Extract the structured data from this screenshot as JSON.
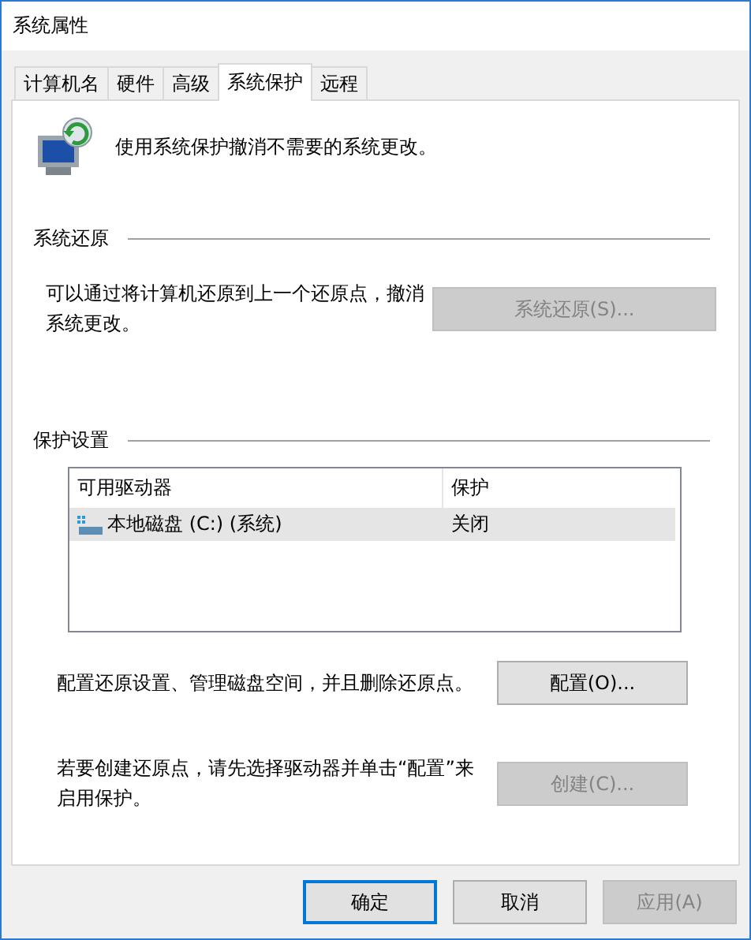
{
  "window": {
    "title": "系统属性"
  },
  "tabs": [
    {
      "label": "计算机名",
      "selected": false
    },
    {
      "label": "硬件",
      "selected": false
    },
    {
      "label": "高级",
      "selected": false
    },
    {
      "label": "系统保护",
      "selected": true
    },
    {
      "label": "远程",
      "selected": false
    }
  ],
  "intro": "使用系统保护撤消不需要的系统更改。",
  "restore": {
    "heading": "系统还原",
    "text": "可以通过将计算机还原到上一个还原点，撤消系统更改。",
    "button": {
      "label": "系统还原(S)...",
      "disabled": true
    }
  },
  "protection": {
    "heading": "保护设置",
    "columns": [
      "可用驱动器",
      "保护"
    ],
    "rows": [
      {
        "name": "本地磁盘 (C:) (系统)",
        "protection": "关闭",
        "selected": true
      }
    ],
    "configure": {
      "text": "配置还原设置、管理磁盘空间，并且删除还原点。",
      "button": {
        "label": "配置(O)...",
        "disabled": false
      }
    },
    "create": {
      "text": "若要创建还原点，请先选择驱动器并单击“配置”来启用保护。",
      "button": {
        "label": "创建(C)...",
        "disabled": true
      }
    }
  },
  "buttons": [
    {
      "label": "确定",
      "default": true,
      "disabled": false
    },
    {
      "label": "取消",
      "default": false,
      "disabled": false
    },
    {
      "label": "应用(A)",
      "default": false,
      "disabled": true
    }
  ]
}
